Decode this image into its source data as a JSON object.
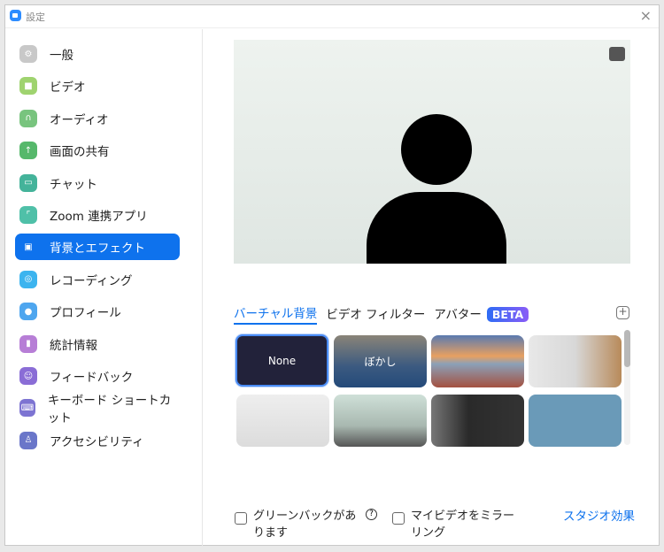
{
  "window": {
    "title": "設定",
    "close": "×"
  },
  "sidebar": {
    "items": [
      {
        "label": "一般",
        "color": "#c8c8c8",
        "icon": "⚙"
      },
      {
        "label": "ビデオ",
        "color": "#9fd36f",
        "icon": "■"
      },
      {
        "label": "オーディオ",
        "color": "#78c47e",
        "icon": "∩"
      },
      {
        "label": "画面の共有",
        "color": "#56b86b",
        "icon": "↑"
      },
      {
        "label": "チャット",
        "color": "#44b39a",
        "icon": "▭"
      },
      {
        "label": "Zoom 連携アプリ",
        "color": "#4fc0a8",
        "icon": "⌜"
      },
      {
        "label": "背景とエフェクト",
        "color": "#0e72ed",
        "icon": "▣"
      },
      {
        "label": "レコーディング",
        "color": "#3cb4ef",
        "icon": "◎"
      },
      {
        "label": "プロフィール",
        "color": "#4ea6ef",
        "icon": "●"
      },
      {
        "label": "統計情報",
        "color": "#b77ed6",
        "icon": "▮"
      },
      {
        "label": "フィードバック",
        "color": "#8a6dd6",
        "icon": "☺"
      },
      {
        "label": "キーボード ショートカット",
        "color": "#7d74d2",
        "icon": "⌨"
      },
      {
        "label": "アクセシビリティ",
        "color": "#6a76c9",
        "icon": "♙"
      }
    ],
    "active": 6
  },
  "tabs": [
    {
      "label": "バーチャル背景"
    },
    {
      "label": "ビデオ フィルター"
    },
    {
      "label": "アバター"
    }
  ],
  "beta": "BETA",
  "add": "+",
  "backgrounds": [
    {
      "label": "None"
    },
    {
      "label": "ぼかし"
    },
    {
      "label": ""
    },
    {
      "label": ""
    },
    {
      "label": ""
    },
    {
      "label": ""
    },
    {
      "label": ""
    },
    {
      "label": ""
    }
  ],
  "options": {
    "green_screen": "グリーンバックがあります",
    "help": "?",
    "mirror": "マイビデオをミラーリング",
    "studio": "スタジオ効果"
  }
}
